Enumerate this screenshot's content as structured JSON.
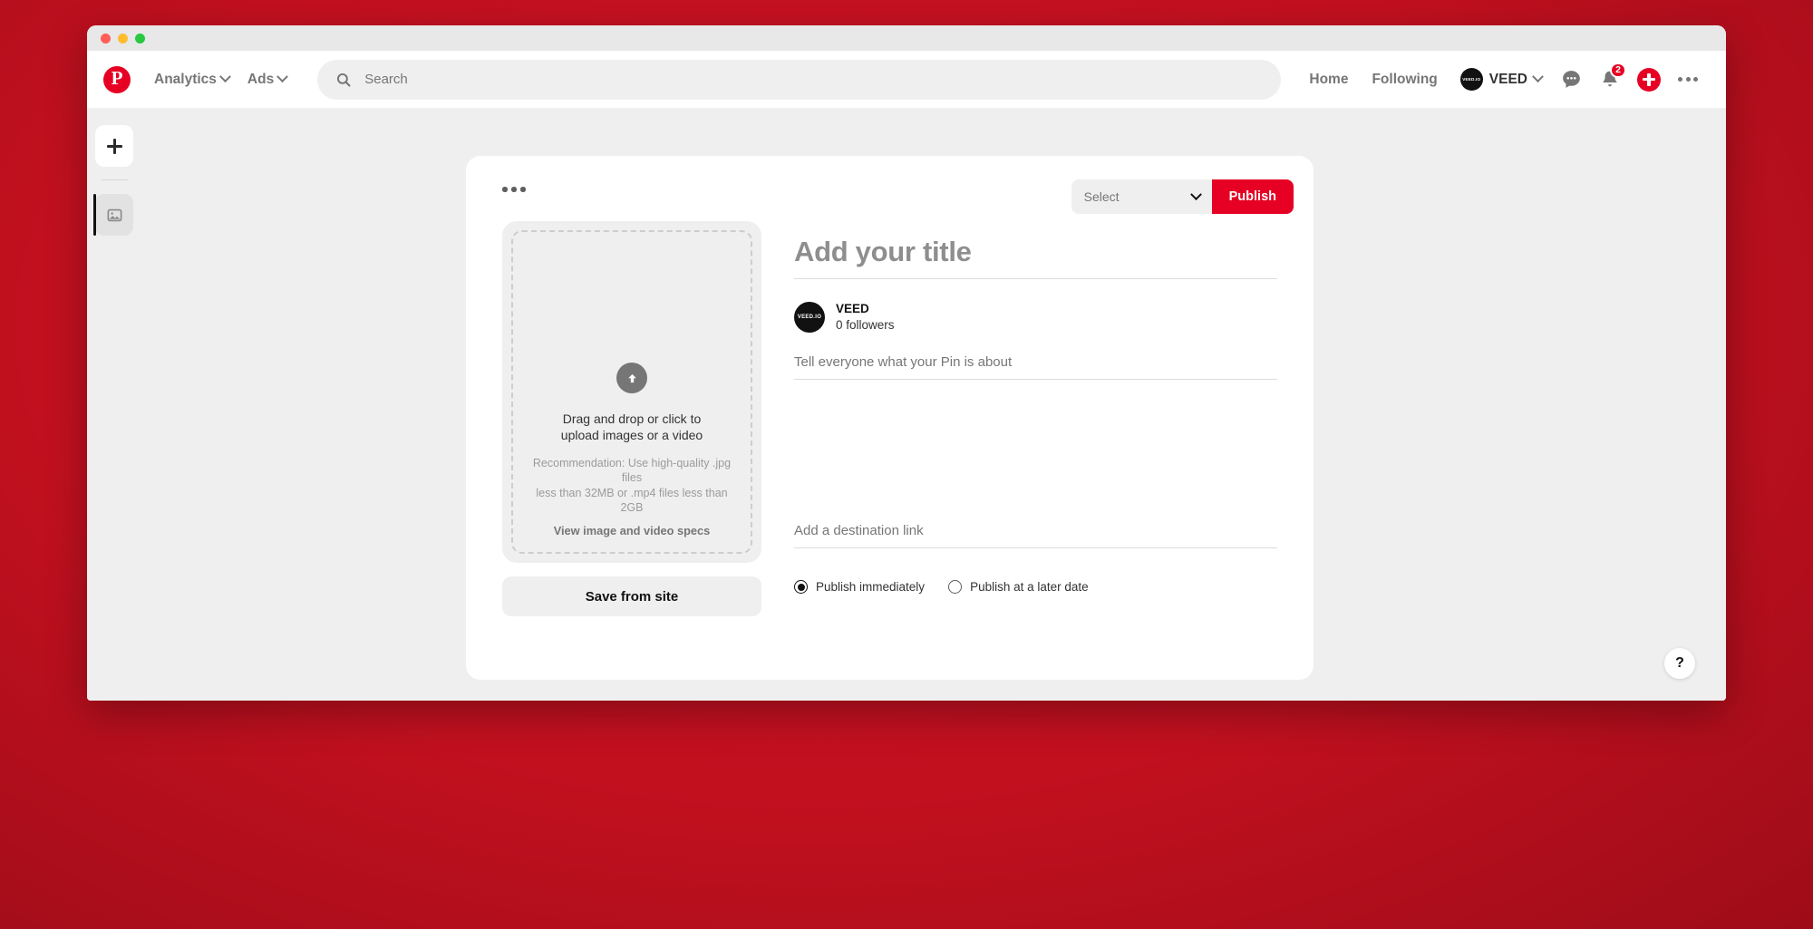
{
  "window": {
    "traffic_lights": [
      "close",
      "minimize",
      "maximize"
    ]
  },
  "header": {
    "logo": "pinterest-logo",
    "nav": [
      {
        "label": "Analytics",
        "icon": "chevron-down-icon"
      },
      {
        "label": "Ads",
        "icon": "chevron-down-icon"
      }
    ],
    "search": {
      "icon": "search-icon",
      "placeholder": "Search"
    },
    "links": [
      {
        "label": "Home"
      },
      {
        "label": "Following"
      }
    ],
    "account": {
      "avatar_text": "VEED.IO",
      "name": "VEED",
      "icon": "chevron-down-icon"
    },
    "messages_icon": "speech-bubble-icon",
    "notifications": {
      "icon": "bell-icon",
      "badge": "2"
    },
    "create_icon": "plus-circle-icon",
    "more_icon": "ellipsis-icon"
  },
  "rail": {
    "create_label": "plus-icon",
    "media_label": "image-icon"
  },
  "pin_builder": {
    "more_menu_icon": "ellipsis-icon",
    "board_select": {
      "value": "Select",
      "icon": "chevron-down-icon"
    },
    "publish_button": "Publish",
    "upload": {
      "icon": "upload-arrow-icon",
      "prompt_line1": "Drag and drop or click to",
      "prompt_line2": "upload images or a video",
      "recommendation_line1": "Recommendation: Use high-quality .jpg files",
      "recommendation_line2": "less than 32MB or .mp4 files less than 2GB",
      "specs_link": "View image and video specs"
    },
    "save_from_site_button": "Save from site",
    "title_placeholder": "Add your title",
    "profile": {
      "avatar_text": "VEED.IO",
      "name": "VEED",
      "followers": "0 followers"
    },
    "description_placeholder": "Tell everyone what your Pin is about",
    "destination_placeholder": "Add a destination link",
    "schedule_options": [
      {
        "label": "Publish immediately",
        "selected": true
      },
      {
        "label": "Publish at a later date",
        "selected": false
      }
    ]
  },
  "help_button": "?",
  "colors": {
    "brand_red": "#e60023",
    "page_backdrop": "#c2101f",
    "app_background": "#efefef",
    "card_background": "#ffffff"
  }
}
